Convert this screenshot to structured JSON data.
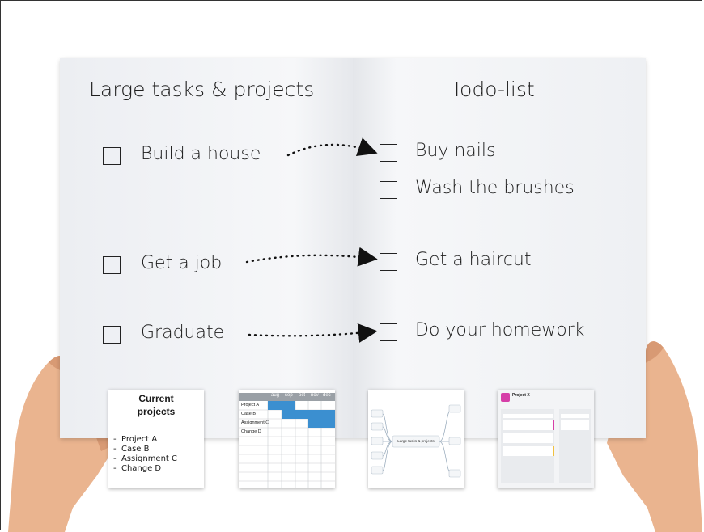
{
  "headings": {
    "left": "Large tasks & projects",
    "right": "Todo-list"
  },
  "large_tasks": [
    {
      "label": "Build a house",
      "checked": false
    },
    {
      "label": "Get a job",
      "checked": false
    },
    {
      "label": "Graduate",
      "checked": false
    }
  ],
  "todos": [
    {
      "label": "Buy nails",
      "checked": false
    },
    {
      "label": "Wash the brushes",
      "checked": false
    },
    {
      "label": "Get a haircut",
      "checked": false
    },
    {
      "label": "Do your homework",
      "checked": false
    }
  ],
  "thumbnails": {
    "current_projects": {
      "title_line1": "Current",
      "title_line2": "projects",
      "items": [
        "Project A",
        "Case B",
        "Assignment C",
        "Change D"
      ]
    },
    "gantt": {
      "months": [
        "aug",
        "sep",
        "oct",
        "nov",
        "dec"
      ],
      "rows": [
        "Project A",
        "Case B",
        "Assignment C",
        "Change D"
      ]
    },
    "mindmap": {
      "center_label": "Large tasks & projects"
    },
    "board": {
      "title": "Project X"
    }
  },
  "colors": {
    "gantt_fill": "#3b8fd0",
    "board_accent": "#d63fa8",
    "checkbox_border": "#222222"
  }
}
